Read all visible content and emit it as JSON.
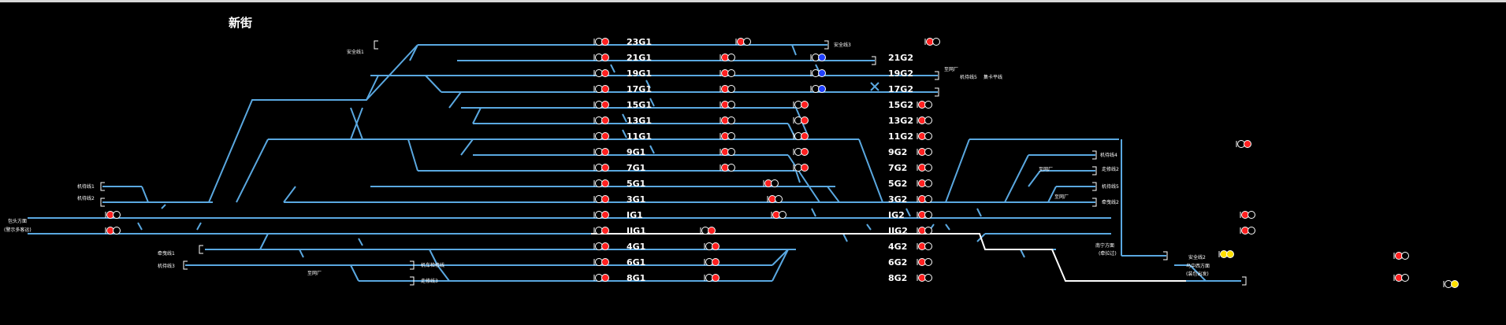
{
  "station": {
    "title": "新街"
  },
  "colors": {
    "track": "#5aa8e0",
    "route": "#ffffff",
    "red": "#ff2020",
    "blue": "#2040ff",
    "yellow": "#ffe000",
    "off": "#000000"
  },
  "tracks": [
    {
      "name": "23G1",
      "west": "23G1",
      "east": ""
    },
    {
      "name": "21",
      "west": "21G1",
      "east": "21G2"
    },
    {
      "name": "19",
      "west": "19G1",
      "east": "19G2"
    },
    {
      "name": "17",
      "west": "17G1",
      "east": "17G2"
    },
    {
      "name": "15",
      "west": "15G1",
      "east": "15G2"
    },
    {
      "name": "13",
      "west": "13G1",
      "east": "13G2"
    },
    {
      "name": "11",
      "west": "11G1",
      "east": "11G2"
    },
    {
      "name": "9",
      "west": "9G1",
      "east": "9G2"
    },
    {
      "name": "7",
      "west": "7G1",
      "east": "7G2"
    },
    {
      "name": "5",
      "west": "5G1",
      "east": "5G2"
    },
    {
      "name": "3",
      "west": "3G1",
      "east": "3G2"
    },
    {
      "name": "I",
      "west": "IG1",
      "east": "IG2"
    },
    {
      "name": "II",
      "west": "IIG1",
      "east": "IIG2"
    },
    {
      "name": "4",
      "west": "4G1",
      "east": "4G2"
    },
    {
      "name": "6",
      "west": "6G1",
      "east": "6G2"
    },
    {
      "name": "8",
      "west": "8G1",
      "east": "8G2"
    }
  ],
  "side_labels": [
    "安全线1",
    "安全线3",
    "至网厂",
    "机待线5",
    "集卡平线",
    "机待线1",
    "机待线2",
    "包头方面",
    "(警示多客运)",
    "牵曳线1",
    "机待线3",
    "机车检修线",
    "至网厂",
    "走修线3",
    "机待线4",
    "至网厂",
    "走修线2",
    "机待线5",
    "至网厂",
    "牵曳线2",
    "南宁方面",
    "(牵拉过)",
    "安全线2",
    "乌中西方面",
    "(装包出发)"
  ],
  "signal_states": {
    "west_column": "red",
    "middle_column": "red",
    "blue_group": [
      "19",
      "17",
      "15"
    ],
    "yellow_group": [
      "east-approach-1",
      "east-approach-2",
      "east-exit"
    ]
  },
  "route": {
    "set": true,
    "description": "IIG2"
  }
}
